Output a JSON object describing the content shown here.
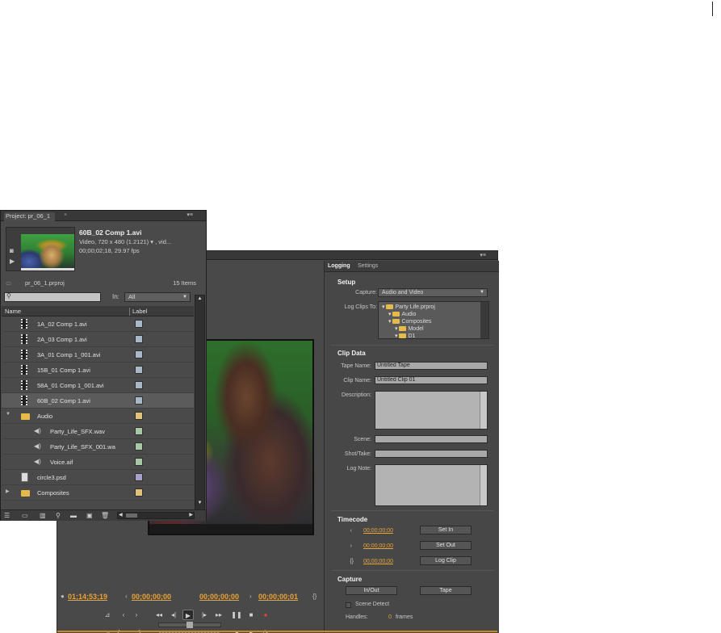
{
  "project_panel": {
    "tab_title": "Project: pr_06_1",
    "clip": {
      "name": "60B_02 Comp 1.avi",
      "info_line1": "Video, 720 x 480 (1.2121)",
      "info_line1_more": ", vid...",
      "info_line2": "00;00;02;18, 29.97 fps"
    },
    "project_file": "pr_06_1.prproj",
    "item_count": "15 Items",
    "search_placeholder": "",
    "in_label": "In:",
    "in_value": "All",
    "columns": {
      "name": "Name",
      "label": "Label"
    },
    "items": [
      {
        "name": "1A_02 Comp 1.avi",
        "type": "video",
        "label_color": "#a8b8c8"
      },
      {
        "name": "2A_03 Comp 1.avi",
        "type": "video",
        "label_color": "#a8b8c8"
      },
      {
        "name": "3A_01 Comp 1_001.avi",
        "type": "video",
        "label_color": "#a8b8c8"
      },
      {
        "name": "15B_01 Comp 1.avi",
        "type": "video",
        "label_color": "#a8b8c8"
      },
      {
        "name": "58A_01 Comp 1_001.avi",
        "type": "video",
        "label_color": "#a8b8c8"
      },
      {
        "name": "60B_02 Comp 1.avi",
        "type": "video",
        "label_color": "#a8b8c8",
        "selected": true
      },
      {
        "name": "Audio",
        "type": "folder-open",
        "label_color": "#e2c27a"
      },
      {
        "name": "Party_Life_SFX.wav",
        "type": "audio",
        "label_color": "#a7c8a5"
      },
      {
        "name": "Party_Life_SFX_001.wa",
        "type": "audio",
        "label_color": "#a7c8a5"
      },
      {
        "name": "Voice.aif",
        "type": "audio",
        "label_color": "#a7c8a5"
      },
      {
        "name": "circle3.psd",
        "type": "image",
        "label_color": "#a8a0c8"
      },
      {
        "name": "Composites",
        "type": "folder",
        "label_color": "#e2c27a"
      }
    ]
  },
  "capture_window": {
    "timecodes": {
      "current": "01;14;53;19",
      "in": "00;00;00;00",
      "out": "00;00;00;00",
      "duration": "00;00;00;01"
    },
    "tabs": {
      "logging": "Logging",
      "settings": "Settings"
    },
    "setup": {
      "title": "Setup",
      "capture_label": "Capture:",
      "capture_value": "Audio and Video",
      "log_clips_to_label": "Log Clips To:",
      "tree": [
        "Party Life.prproj",
        "Audio",
        "Composites",
        "Model",
        "D1"
      ]
    },
    "clip_data": {
      "title": "Clip Data",
      "tape_name_label": "Tape Name:",
      "tape_name_value": "Untitled Tape",
      "clip_name_label": "Clip Name:",
      "clip_name_value": "Untitled Clip 01",
      "description_label": "Description:",
      "scene_label": "Scene:",
      "shot_take_label": "Shot/Take:",
      "log_note_label": "Log Note:"
    },
    "timecode": {
      "title": "Timecode",
      "in_value": "00;00;00;00",
      "out_value": "00;00;00;00",
      "dur_value": "00;00;00;00",
      "set_in": "Set In",
      "set_out": "Set Out",
      "log_clip": "Log Clip"
    },
    "capture": {
      "title": "Capture",
      "in_out": "In/Out",
      "tape": "Tape",
      "scene_detect": "Scene Detect",
      "handles_label": "Handles:",
      "handles_value": "0",
      "handles_unit": "frames"
    }
  }
}
